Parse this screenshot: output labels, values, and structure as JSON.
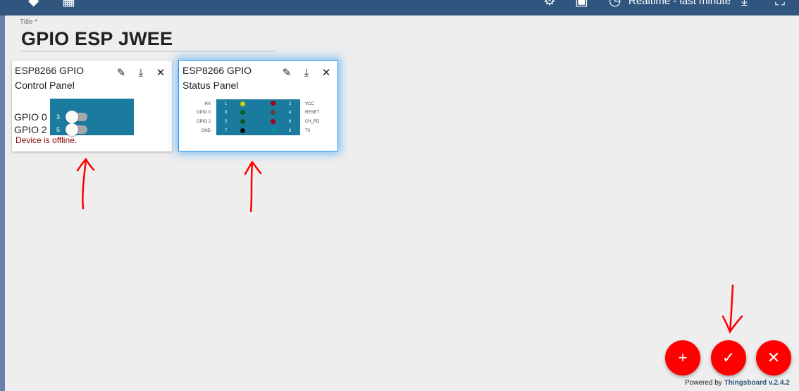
{
  "header": {
    "icons": [
      "layers-icon",
      "dashboard-icon",
      "settings-icon",
      "entity-aliases-icon",
      "clock-icon",
      "download-icon",
      "fullscreen-icon"
    ],
    "timewindow_label": "Realtime - last minute",
    "background": "#305680"
  },
  "title_field": {
    "label": "Title *",
    "value": "GPIO ESP JWEE"
  },
  "widgets": [
    {
      "title": "ESP8266 GPIO Control Panel",
      "actions": [
        "edit-icon",
        "download-icon",
        "close-icon"
      ],
      "gpio": [
        {
          "label": "GPIO 0",
          "pin": "3",
          "on": false
        },
        {
          "label": "GPIO 2",
          "pin": "5",
          "on": false
        }
      ],
      "status_text": "Device is offline."
    },
    {
      "title": "ESP8266 GPIO Status Panel",
      "actions": [
        "edit-icon",
        "download-icon",
        "close-icon"
      ],
      "left_labels": [
        "RX",
        "GPIO 0",
        "GPIO 2",
        "GND"
      ],
      "left_pins": [
        "1",
        "3",
        "5",
        "7"
      ],
      "right_pins": [
        "2",
        "4",
        "6",
        "8"
      ],
      "right_labels": [
        "VCC",
        "RESET",
        "CH_PD",
        "TX"
      ],
      "left_led_colors": [
        "#c6d400",
        "#0b5a1e",
        "#0b5a1e",
        "#0a0a0a"
      ],
      "right_led_colors": [
        "#a50013",
        "#5c4438",
        "#a50013",
        "#009a8c"
      ]
    }
  ],
  "fab_buttons": [
    {
      "name": "add-widget-button",
      "icon": "plus-icon",
      "glyph": "+"
    },
    {
      "name": "apply-changes-button",
      "icon": "check-icon",
      "glyph": "✓"
    },
    {
      "name": "decline-changes-button",
      "icon": "close-icon",
      "glyph": "✕"
    }
  ],
  "footer": {
    "prefix": "Powered by",
    "link": "Thingsboard v.2.4.2"
  },
  "colors": {
    "accent": "#ff0000",
    "panel": "#1a7b9e",
    "annotation": "#ff0000"
  }
}
